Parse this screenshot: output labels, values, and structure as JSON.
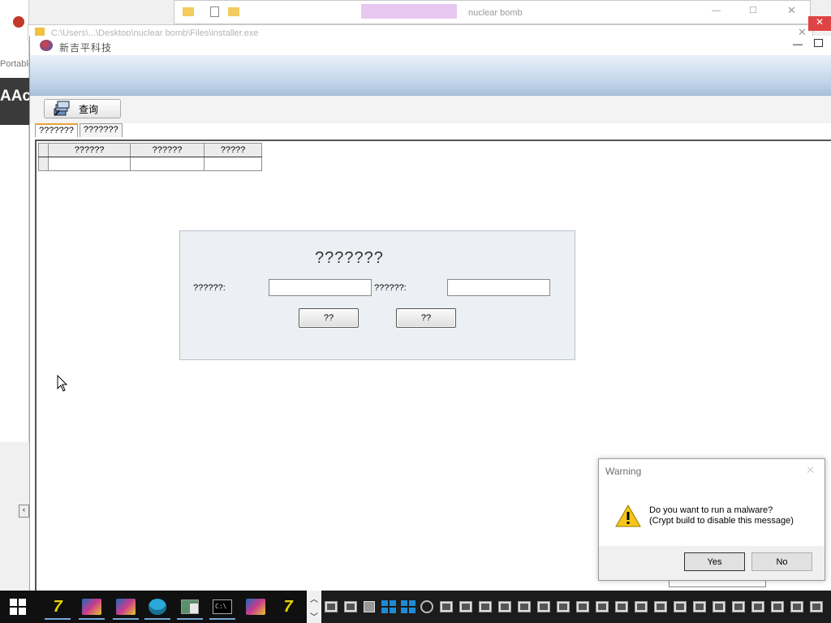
{
  "bg_windows": {
    "explorer_tab": "nuclear bomb",
    "path_title": "C:\\Users\\...\\Desktop\\nuclear bomb\\Files\\installer.exe",
    "portable_label": "Portable",
    "aact_label": "AAct"
  },
  "app": {
    "title": "新吉平科技",
    "toolbar": {
      "query_label": "查询"
    },
    "tabs": [
      "???????",
      "???????"
    ],
    "grid": {
      "columns": [
        "??????",
        "??????",
        "?????"
      ]
    },
    "login_panel": {
      "title": "???????",
      "field1_label": "??????:",
      "field2_label": "??????:",
      "field1_value": "",
      "field2_value": "",
      "button1_label": "??",
      "button2_label": "??"
    }
  },
  "warning_dialog": {
    "title": "Warning",
    "message_line1": "Do you want to run a malware?",
    "message_line2": "(Crypt build to disable this message)",
    "yes_label": "Yes",
    "no_label": "No"
  },
  "taskbar": {
    "apps": [
      "7z-icon",
      "winrar-icon",
      "winrar-icon",
      "stack-icon",
      "window-icon",
      "terminal-icon",
      "winrar-icon",
      "7z-icon"
    ],
    "scroll_up": "^",
    "scroll_down": "v"
  }
}
